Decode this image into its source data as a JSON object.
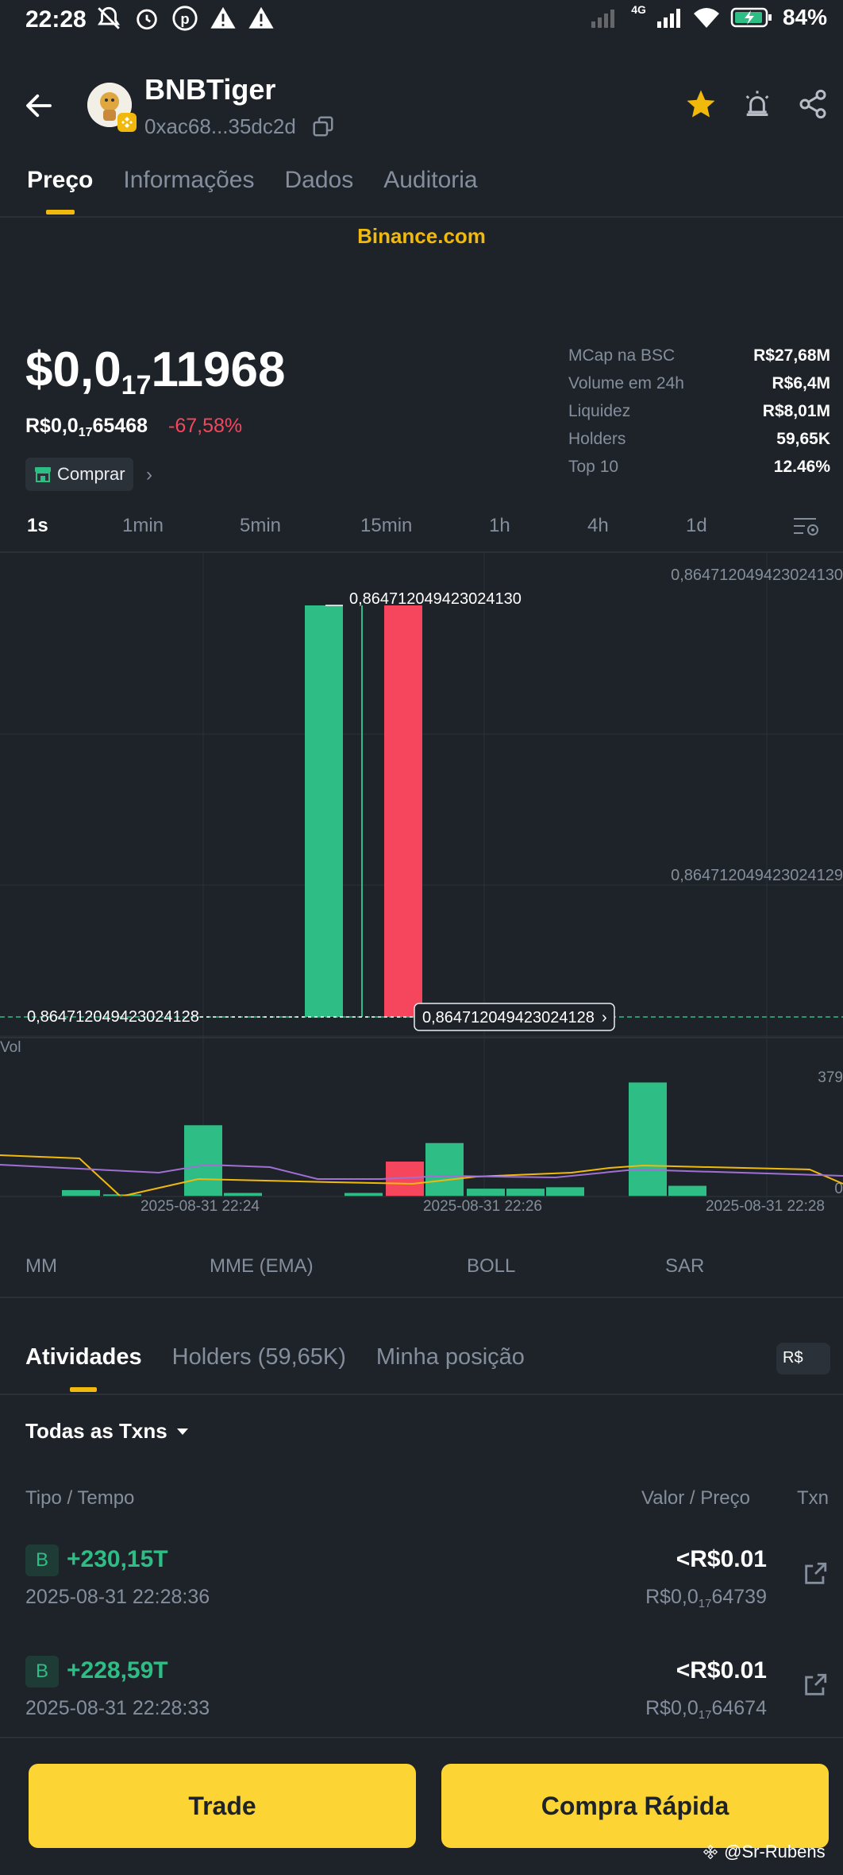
{
  "status_bar": {
    "time": "22:28",
    "network": "4G",
    "battery": "84%"
  },
  "header": {
    "token_name": "BNBTiger",
    "address": "0xac68...35dc2d"
  },
  "tabs": [
    "Preço",
    "Informações",
    "Dados",
    "Auditoria"
  ],
  "banner": "Binance.com",
  "price": {
    "usd_prefix": "$0,0",
    "usd_sub": "17",
    "usd_digits": "11968",
    "brl_prefix": "R$0,0",
    "brl_sub": "17",
    "brl_digits": "65468",
    "change": "-67,58%",
    "buy_label": "Comprar"
  },
  "stats": [
    {
      "k": "MCap na BSC",
      "v": "R$27,68M"
    },
    {
      "k": "Volume em 24h",
      "v": "R$6,4M"
    },
    {
      "k": "Liquidez",
      "v": "R$8,01M"
    },
    {
      "k": "Holders",
      "v": "59,65K"
    },
    {
      "k": "Top 10",
      "v": "12.46%"
    }
  ],
  "intervals": [
    "1s",
    "1min",
    "5min",
    "15min",
    "1h",
    "4h",
    "1d"
  ],
  "chart_data": {
    "type": "candlestick",
    "y_labels": [
      "0,864712049423024130",
      "0,864712049423024129",
      "0,864712049423024128"
    ],
    "high_label": "0,864712049423024130",
    "low_label": "0,864712049423024128",
    "current_label": "0,864712049423024128",
    "x_labels": [
      "2025-08-31 22:24",
      "2025-08-31 22:26",
      "2025-08-31 22:28"
    ],
    "volume_label": "Vol",
    "volume_axis": [
      "379",
      "0"
    ],
    "candles": [
      {
        "open": 0.8647120494230242,
        "close": 0.8647120494230242,
        "dir": "up"
      },
      {
        "open": 0.8647120494230242,
        "close": 0.8647120494230242,
        "dir": "up",
        "thin": true
      },
      {
        "open": 0.8647120494230242,
        "close": 0.8647120494230242,
        "dir": "down"
      }
    ],
    "volumes": [
      {
        "v": 18,
        "dir": "up"
      },
      {
        "v": 6,
        "dir": "up"
      },
      {
        "v": 200,
        "dir": "up"
      },
      {
        "v": 10,
        "dir": "up"
      },
      {
        "v": 10,
        "dir": "up"
      },
      {
        "v": 98,
        "dir": "down"
      },
      {
        "v": 150,
        "dir": "up"
      },
      {
        "v": 22,
        "dir": "up"
      },
      {
        "v": 22,
        "dir": "up"
      },
      {
        "v": 26,
        "dir": "up"
      },
      {
        "v": 320,
        "dir": "up"
      },
      {
        "v": 30,
        "dir": "up"
      }
    ]
  },
  "indicators": [
    "MM",
    "MME (EMA)",
    "BOLL",
    "SAR"
  ],
  "activity_tabs": [
    "Atividades",
    "Holders (59,65K)",
    "Minha posição"
  ],
  "currency": "R$",
  "filter": "Todas as Txns",
  "columns": {
    "left": "Tipo / Tempo",
    "right": "Valor / Preço",
    "txn": "Txn"
  },
  "transactions": [
    {
      "type": "B",
      "amount": "+230,15T",
      "time": "2025-08-31 22:28:36",
      "value": "<R$0.01",
      "price_prefix": "R$0,0",
      "price_sub": "17",
      "price_digits": "64739"
    },
    {
      "type": "B",
      "amount": "+228,59T",
      "time": "2025-08-31 22:28:33",
      "value": "<R$0.01",
      "price_prefix": "R$0,0",
      "price_sub": "17",
      "price_digits": "64674"
    }
  ],
  "buttons": {
    "trade": "Trade",
    "quick": "Compra Rápida"
  },
  "watermark": "@Sr-Rubens"
}
